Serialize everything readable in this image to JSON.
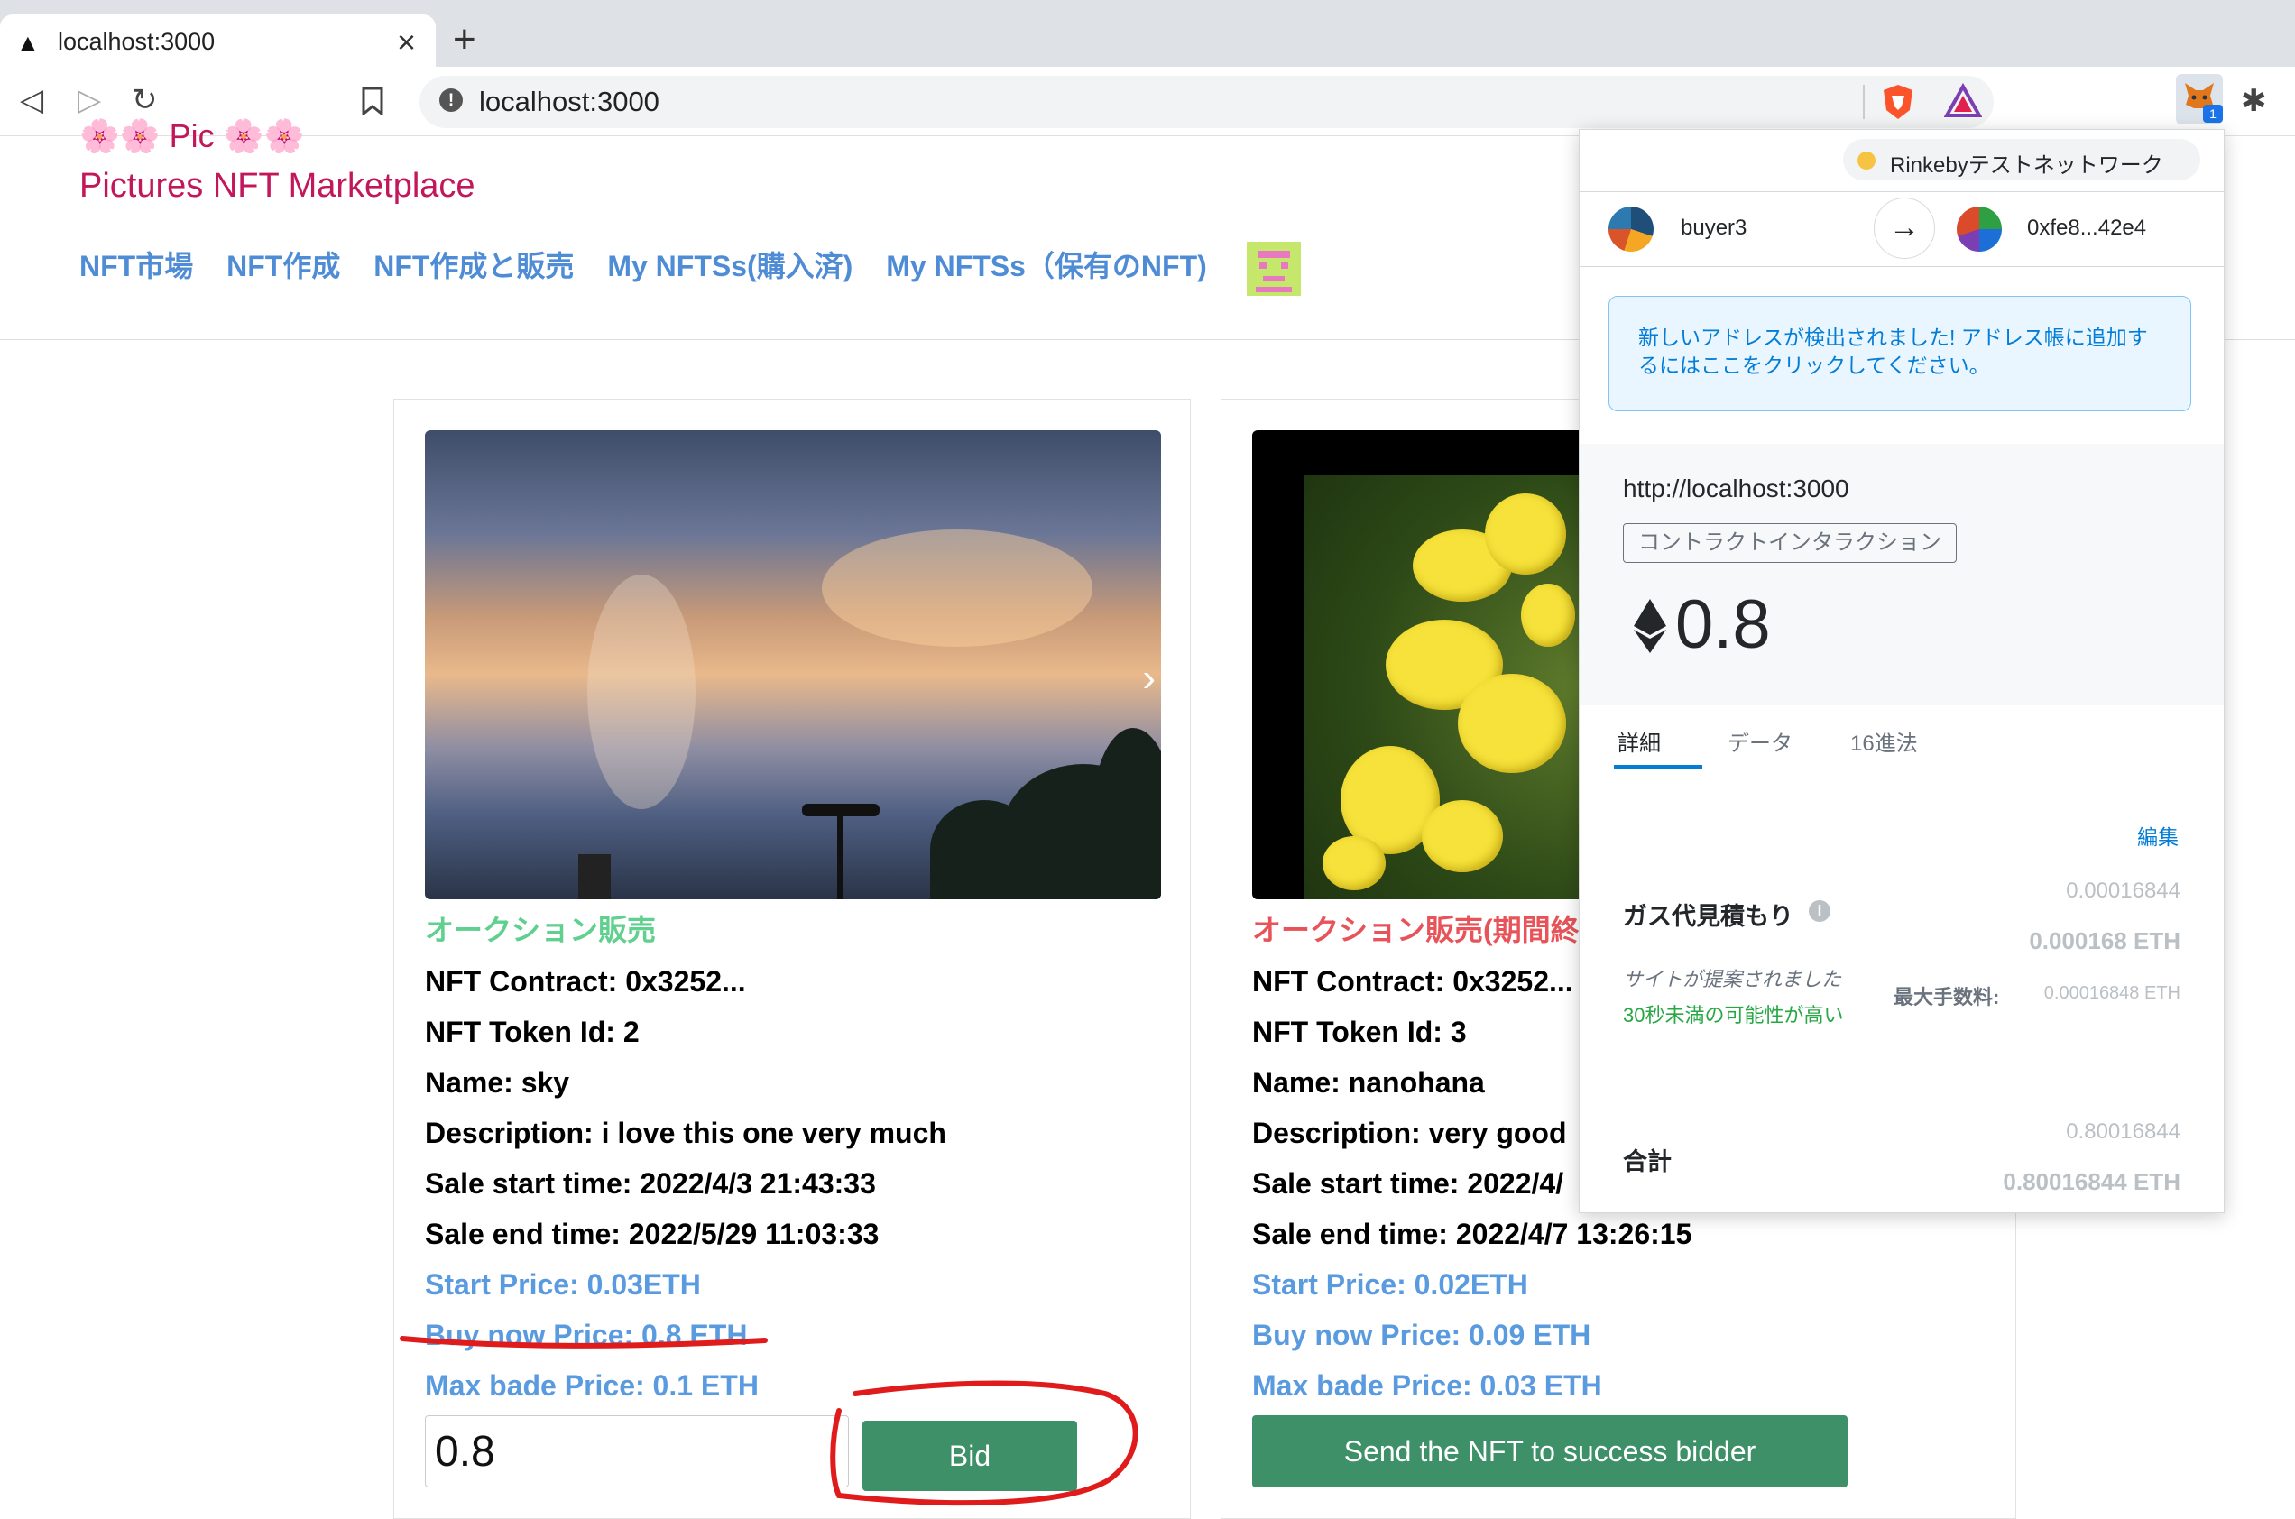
{
  "browser": {
    "tab_title": "localhost:3000",
    "tab_icon": "triangle-favicon-icon",
    "url": "localhost:3000"
  },
  "site": {
    "title_top": "🌸🌸 Pic 🌸🌸",
    "title": "Pictures NFT Marketplace",
    "nav": [
      "NFT市場",
      "NFT作成",
      "NFT作成と販売",
      "My NFTSs(購入済)",
      "My NFTSs（保有のNFT)"
    ]
  },
  "cards": [
    {
      "status": "オークション販売",
      "contract": "NFT Contract: 0x3252...",
      "token_id": "NFT Token Id: 2",
      "name": "Name: sky",
      "description": "Description: i love this one very much",
      "start_time": "Sale start time: 2022/4/3 21:43:33",
      "end_time": "Sale end time: 2022/5/29 11:03:33",
      "start_price": "Start Price: 0.03ETH",
      "buy_now_price": "Buy now Price: 0.8 ETH",
      "max_bid_price": "Max bade Price: 0.1 ETH",
      "bid_value": "0.8",
      "bid_button": "Bid",
      "carousel_next": "›"
    },
    {
      "status": "オークション販売(期間終",
      "contract": "NFT Contract: 0x3252...",
      "token_id": "NFT Token Id: 3",
      "name": "Name: nanohana",
      "description": "Description: very good",
      "start_time": "Sale start time: 2022/4/",
      "end_time": "Sale end time: 2022/4/7 13:26:15",
      "start_price": "Start Price: 0.02ETH",
      "buy_now_price": "Buy now Price: 0.09 ETH",
      "max_bid_price": "Max bade Price: 0.03 ETH",
      "send_button": "Send the NFT to success bidder"
    }
  ],
  "metamask": {
    "network": "Rinkebyテストネットワーク",
    "from_account": "buyer3",
    "to_account": "0xfe8...42e4",
    "notice": "新しいアドレスが検出されました! アドレス帳に追加するにはここをクリックしてください。",
    "origin": "http://localhost:3000",
    "type_label": "コントラクトインタラクション",
    "amount": "0.8",
    "tabs": [
      "詳細",
      "データ",
      "16進法"
    ],
    "edit": "編集",
    "gas_label": "ガス代見積もり",
    "gas_value": "0.00016844",
    "gas_eth": "0.000168 ETH",
    "site_suggested": "サイトが提案されました",
    "likely": "30秒未満の可能性が高い",
    "max_fee_label": "最大手数料:",
    "max_fee_value": "0.00016848 ETH",
    "total_label": "合計",
    "total_value": "0.80016844",
    "total_eth": "0.80016844 ETH",
    "badge_count": "1"
  },
  "colors": {
    "accent_pink": "#c2185b",
    "nav_blue": "#4f8cd6",
    "status_green": "#5fd08e",
    "status_red": "#e8535a",
    "price_blue": "#5a9be0",
    "button_green": "#3d9068",
    "metamask_blue": "#037dd6",
    "annotation_red": "#e01b1b"
  }
}
